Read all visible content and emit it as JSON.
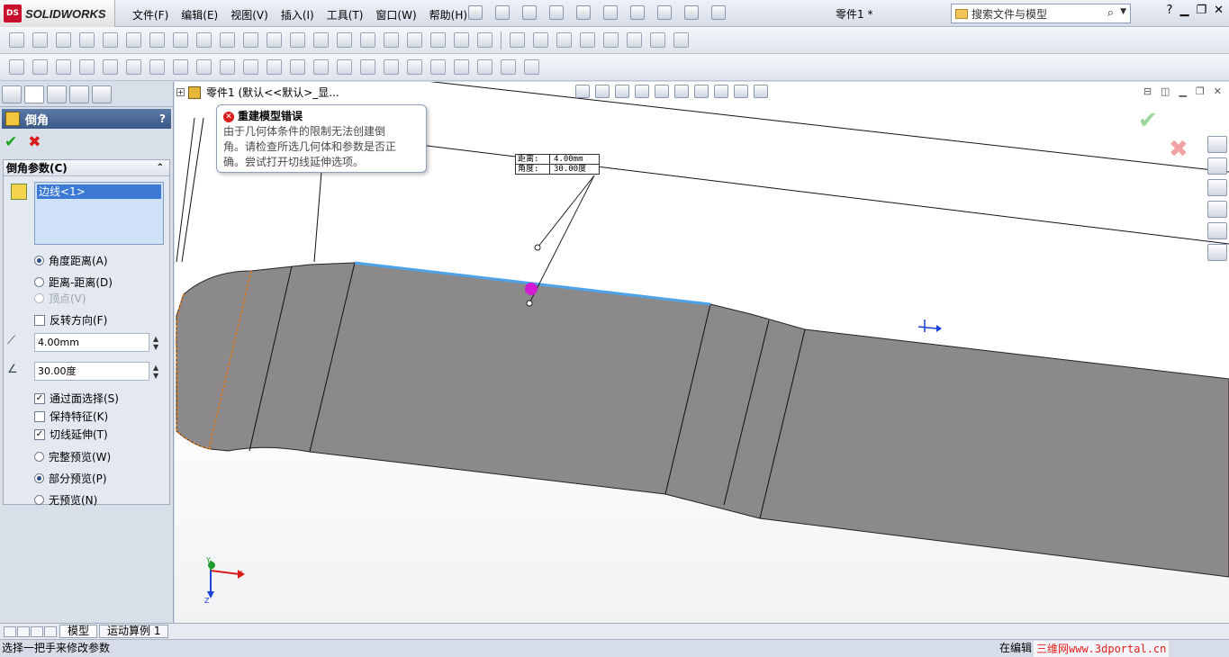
{
  "app": {
    "brand_ds": "DS",
    "brand_name": "SOLIDWORKS",
    "document_title": "零件1 *",
    "menus": [
      "文件(F)",
      "编辑(E)",
      "视图(V)",
      "插入(I)",
      "工具(T)",
      "窗口(W)",
      "帮助(H)"
    ],
    "search_placeholder": "搜索文件与模型",
    "help_glyph": "?"
  },
  "property_manager": {
    "title": "倒角",
    "help": "?",
    "ok_glyph": "✔",
    "cancel_glyph": "✖",
    "group_title": "倒角参数(C)",
    "selected_items": [
      "边线<1>"
    ],
    "chamfer_types": [
      {
        "label": "角度距离(A)",
        "selected": true,
        "enabled": true
      },
      {
        "label": "距离-距离(D)",
        "selected": false,
        "enabled": true
      },
      {
        "label": "顶点(V)",
        "selected": false,
        "enabled": false
      }
    ],
    "flip_direction": {
      "label": "反转方向(F)",
      "checked": false
    },
    "distance_value": "4.00mm",
    "angle_value": "30.00度",
    "options": [
      {
        "label": "通过面选择(S)",
        "checked": true
      },
      {
        "label": "保持特征(K)",
        "checked": false
      },
      {
        "label": "切线延伸(T)",
        "checked": true
      }
    ],
    "preview_modes": [
      {
        "label": "完整预览(W)",
        "selected": false
      },
      {
        "label": "部分预览(P)",
        "selected": true
      },
      {
        "label": "无预览(N)",
        "selected": false
      }
    ]
  },
  "graphics": {
    "tree_item": "零件1 (默认<<默认>_显...",
    "error": {
      "title": "重建模型错误",
      "message": "由于几何体条件的限制无法创建倒\n角。请检查所选几何体和参数是否正\n确。尝试打开切线延伸选项。"
    },
    "callout": {
      "distance_label": "距离:",
      "distance_value": "4.00mm",
      "angle_label": "角度:",
      "angle_value": "30.00度"
    },
    "triad": {
      "x": "X",
      "y": "Y",
      "z": "Z"
    },
    "colors": {
      "part_fill": "#8c898a",
      "selected_edge": "#4ea3e8",
      "handle": "#d21bd2",
      "preview_edge": "#e07b1a"
    }
  },
  "bottom_tabs": [
    "模型",
    "运动算例 1"
  ],
  "status": {
    "left": "选择一把手来修改参数",
    "right": "在编辑",
    "watermark": "三维网www.3dportal.cn"
  }
}
